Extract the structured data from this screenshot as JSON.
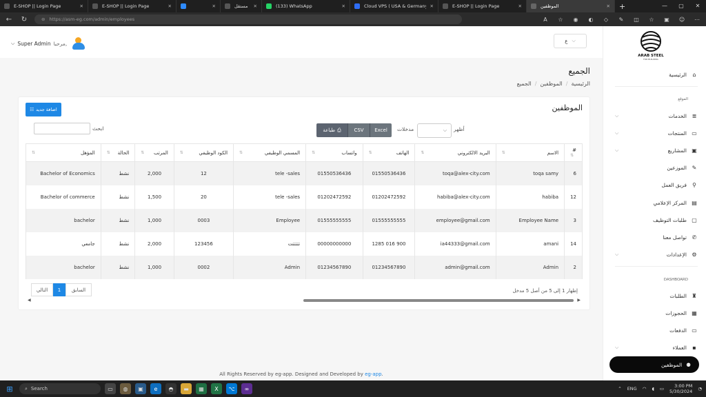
{
  "browser": {
    "tabs": [
      {
        "title": "E-SHOP || Login Page",
        "color": "#555",
        "active": false,
        "w": 128
      },
      {
        "title": "E-SHOP || Login Page",
        "color": "#555",
        "active": false,
        "w": 128
      },
      {
        "title": "",
        "color": "#2e8bff",
        "active": false,
        "w": 64
      },
      {
        "title": "الرسائل | مستقل",
        "color": "#555",
        "active": false,
        "w": 60
      },
      {
        "title": "(133) WhatsApp",
        "color": "#25d366",
        "active": false,
        "w": 128
      },
      {
        "title": "Cloud VPS ( USA & Germany & F",
        "color": "#2e6df6",
        "active": false,
        "w": 128
      },
      {
        "title": "E-SHOP || Login Page",
        "color": "#555",
        "active": false,
        "w": 128
      },
      {
        "title": "الموظفين",
        "color": "#666",
        "active": true,
        "w": 128
      }
    ],
    "url": "https://asm-eg.com/admin/employees"
  },
  "header": {
    "lang_button": "ع",
    "greeting": "مرحبا,",
    "user": "Super Admin"
  },
  "page": {
    "title": "الجميع",
    "breadcrumb": [
      "الرئيسية",
      "الموظفين",
      "الجميع"
    ]
  },
  "card": {
    "title": "الموظفين",
    "add_button": "اضافة جديد",
    "show_label": "أظهر",
    "entries_label": "مدخلات",
    "buttons": [
      "Excel",
      "CSV",
      "طباعة"
    ],
    "search_label": "ابحث",
    "search_value": ""
  },
  "table": {
    "headers": [
      "#",
      "الاسم",
      "البريد الالكتروني",
      "الهاتف",
      "واتساب",
      "المسمي الوظيفي",
      "الكود الوظيفي",
      "المرتب",
      "الحالة",
      "المؤهل"
    ],
    "rows": [
      [
        "6",
        "toqa samy",
        "toqa@alex-city.com",
        "01550536436",
        "01550536436",
        "tele -sales",
        "12",
        "2,000",
        "نشط",
        "Bachelor of Economics"
      ],
      [
        "12",
        "habiba",
        "habiba@alex-city.com",
        "01202472592",
        "01202472592",
        "tele -sales",
        "20",
        "1,500",
        "نشط",
        "Bachelor of commerce"
      ],
      [
        "3",
        "Employee Name",
        "employee@gmail.com",
        "01555555555",
        "01555555555",
        "Employee",
        "0003",
        "1,000",
        "نشط",
        "bachelor"
      ],
      [
        "14",
        "amani",
        "ia44333@gmail.com",
        "900 016 1285",
        "00000000000",
        "تتتتتت",
        "123456",
        "2,000",
        "نشط",
        "جامعي"
      ],
      [
        "2",
        "Admin",
        "admin@gmail.com",
        "01234567890",
        "01234567890",
        "Admin",
        "0002",
        "1,000",
        "نشط",
        "bachelor"
      ]
    ]
  },
  "pagination": {
    "info": "إظهار 1 إلى 5 من أصل 5 مدخل",
    "prev": "السابق",
    "page": "1",
    "next": "التالي"
  },
  "sidebar": {
    "logo_line1": "ARAB STEEL",
    "logo_line2": "FOR BUILDING",
    "home": "الرئيسية",
    "section_site": "الموقع",
    "items": [
      {
        "label": "الخدمات",
        "icon": "≣",
        "chev": true
      },
      {
        "label": "المنتجات",
        "icon": "▭",
        "chev": true
      },
      {
        "label": "المشاريع",
        "icon": "▣",
        "chev": true
      },
      {
        "label": "الموزعين",
        "icon": "✎",
        "chev": false
      },
      {
        "label": "فريق العمل",
        "icon": "⚲",
        "chev": false
      },
      {
        "label": "المركز الإعلامي",
        "icon": "▤",
        "chev": false
      },
      {
        "label": "طلبات التوظيف",
        "icon": "▢",
        "chev": false
      },
      {
        "label": "تواصل معنا",
        "icon": "✆",
        "chev": false
      },
      {
        "label": "الإعدادات",
        "icon": "⚙",
        "chev": true
      }
    ],
    "section_dashboard": "DASHBOARD",
    "dash_items": [
      {
        "label": "الطلبات",
        "icon": "♜",
        "chev": false
      },
      {
        "label": "الحجوزات",
        "icon": "▦",
        "chev": false
      },
      {
        "label": "الدفعات",
        "icon": "▭",
        "chev": false
      },
      {
        "label": "العملاء",
        "icon": "▪",
        "chev": true
      }
    ],
    "active": "الموظفين"
  },
  "footer": {
    "text": "All Rights Reserved by eg-app. Designed and Developed by",
    "link": "eg-app"
  },
  "taskbar": {
    "search": "Search",
    "lang": "ENG",
    "time": "3:00 PM",
    "date": "5/30/2024"
  }
}
